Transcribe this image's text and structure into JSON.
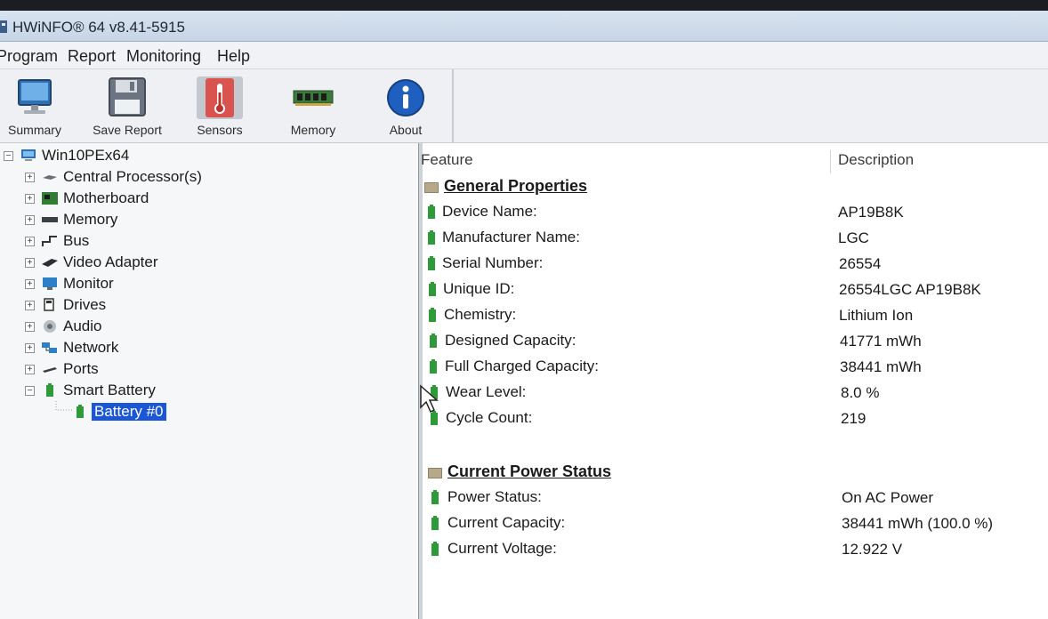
{
  "window": {
    "title": "HWiNFO® 64 v8.41-5915"
  },
  "menu": [
    "Program",
    "Report",
    "Monitoring",
    "Help"
  ],
  "toolbar": [
    {
      "label": "Summary",
      "icon": "monitor-icon"
    },
    {
      "label": "Save Report",
      "icon": "floppy-disk-icon"
    },
    {
      "label": "Sensors",
      "icon": "thermometer-icon"
    },
    {
      "label": "Memory",
      "icon": "memory-module-icon"
    },
    {
      "label": "About",
      "icon": "info-icon"
    }
  ],
  "tree": {
    "root": "Win10PEx64",
    "items": [
      {
        "label": "Central Processor(s)",
        "icon": "cpu-icon"
      },
      {
        "label": "Motherboard",
        "icon": "motherboard-icon"
      },
      {
        "label": "Memory",
        "icon": "memory-icon"
      },
      {
        "label": "Bus",
        "icon": "bus-icon"
      },
      {
        "label": "Video Adapter",
        "icon": "video-adapter-icon"
      },
      {
        "label": "Monitor",
        "icon": "monitor-icon"
      },
      {
        "label": "Drives",
        "icon": "drive-icon"
      },
      {
        "label": "Audio",
        "icon": "audio-icon"
      },
      {
        "label": "Network",
        "icon": "network-icon"
      },
      {
        "label": "Ports",
        "icon": "ports-icon"
      },
      {
        "label": "Smart Battery",
        "icon": "battery-icon"
      }
    ],
    "selected_child": "Battery #0"
  },
  "details": {
    "columns": [
      "Feature",
      "Description"
    ],
    "sections": [
      {
        "title": "General Properties",
        "rows": [
          {
            "feature": "Device Name:",
            "value": "AP19B8K"
          },
          {
            "feature": "Manufacturer Name:",
            "value": "LGC"
          },
          {
            "feature": "Serial Number:",
            "value": "26554"
          },
          {
            "feature": "Unique ID:",
            "value": "26554LGC AP19B8K"
          },
          {
            "feature": "Chemistry:",
            "value": "Lithium Ion"
          },
          {
            "feature": "Designed Capacity:",
            "value": "41771 mWh"
          },
          {
            "feature": "Full Charged Capacity:",
            "value": "38441 mWh"
          },
          {
            "feature": "Wear Level:",
            "value": "8.0 %"
          },
          {
            "feature": "Cycle Count:",
            "value": "219"
          }
        ]
      },
      {
        "title": "Current Power Status",
        "rows": [
          {
            "feature": "Power Status:",
            "value": "On AC Power"
          },
          {
            "feature": "Current Capacity:",
            "value": "38441 mWh (100.0 %)"
          },
          {
            "feature": "Current Voltage:",
            "value": "12.922 V"
          }
        ]
      }
    ]
  },
  "colors": {
    "selection": "#1a56d6",
    "battery_green": "#2f9a3a",
    "section_icon": "#b8a88a"
  }
}
